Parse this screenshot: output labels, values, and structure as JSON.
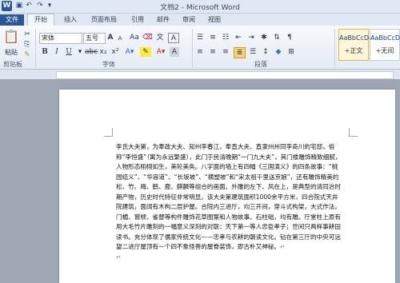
{
  "window": {
    "title": "文档2 - Microsoft Word"
  },
  "tabs": {
    "file": "文件",
    "home": "开始",
    "insert": "插入",
    "layout": "页面布局",
    "refs": "引用",
    "mail": "邮件",
    "review": "审阅",
    "view": "视图"
  },
  "clipboard": {
    "paste": "粘贴",
    "group": "剪贴板"
  },
  "font": {
    "name": "宋体",
    "size": "五号",
    "bold": "B",
    "italic": "I",
    "underline": "U",
    "grow": "A",
    "shrink": "A",
    "group": "字体"
  },
  "paragraph": {
    "group": "段落"
  },
  "styles": [
    {
      "preview": "AaBbCcDc",
      "name": "+正文"
    },
    {
      "preview": "AaBbCcDc",
      "name": "+无间"
    }
  ],
  "document": {
    "body": "李氏大夫第，为奉政大夫、知州李春江，奉直大夫、直隶州州同李奇川的宅邸，俗称“李恒盛”（寓为永远繁盛），此门于民清晚期“一门九大夫”，其门楼雕饰精致细腻，人物形态栩栩如生，美轮美奂。八字面的墙上有四幅《三国演义》的四条故事：“桃园结义”、“华容道”、“长坂坡”、“横塑坡”和“宋太祖千里送京娘”，还有雕饰精美的松、竹、梅、鹤、鹿、麒麟等组合的画面。外雕的左下、风在上，是典型的清同治时期产物，历史时代特征非常明显。该大夫第建筑面积1000余平方米，四合院式天井院建筑，面阔有木构二层护屋。合院内三进厅，均三开间，穿斗式构架，大式作法。门楣、窗棂、雀替等构件雕饰花草图案和人物故事。石柱础，均有雕。厅堂柱上原有用大毛竹片雕刻的一幅意义深刻的对联：天下第一等人忠臣孝子；世间只两样事耕田读书。充分体现了儒家传统文化——忠孝与农耕的朝读文化。钻在第三厅的中央可远望二进厅屋顶有一个四不象怪兽的屋脊装饰，即古朴又神秘。"
  }
}
